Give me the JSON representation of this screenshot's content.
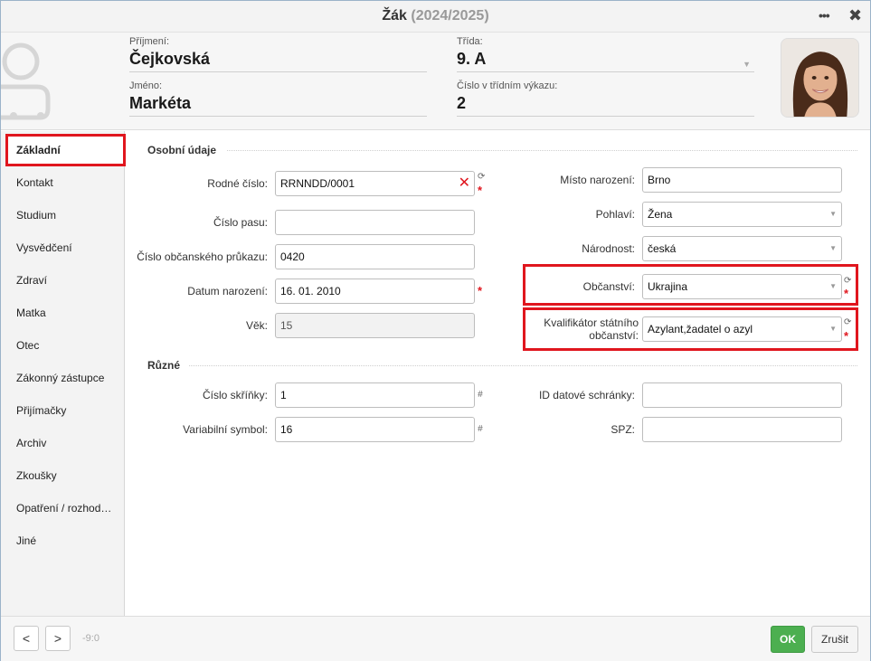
{
  "window": {
    "title": "Žák",
    "year": "(2024/2025)"
  },
  "header": {
    "surname_label": "Příjmení:",
    "surname": "Čejkovská",
    "name_label": "Jméno:",
    "name": "Markéta",
    "class_label": "Třída:",
    "class": "9. A",
    "class_number_label": "Číslo v třídním výkazu:",
    "class_number": "2"
  },
  "sidebar": {
    "items": [
      {
        "label": "Základní"
      },
      {
        "label": "Kontakt"
      },
      {
        "label": "Studium"
      },
      {
        "label": "Vysvědčení"
      },
      {
        "label": "Zdraví"
      },
      {
        "label": "Matka"
      },
      {
        "label": "Otec"
      },
      {
        "label": "Zákonný zástupce"
      },
      {
        "label": "Přijímačky"
      },
      {
        "label": "Archiv"
      },
      {
        "label": "Zkoušky"
      },
      {
        "label": "Opatření / rozhod…"
      },
      {
        "label": "Jiné"
      }
    ]
  },
  "sections": {
    "personal": "Osobní údaje",
    "misc": "Různé"
  },
  "fields": {
    "birth_number": {
      "label": "Rodné číslo:",
      "value": "RRNNDD/0001"
    },
    "passport": {
      "label": "Číslo pasu:",
      "value": ""
    },
    "id_card": {
      "label": "Číslo občanského průkazu:",
      "value": "0420"
    },
    "birth_date": {
      "label": "Datum narození:",
      "value": "16. 01. 2010"
    },
    "age": {
      "label": "Věk:",
      "value": "15"
    },
    "birth_place": {
      "label": "Místo narození:",
      "value": "Brno"
    },
    "gender": {
      "label": "Pohlaví:",
      "value": "Žena"
    },
    "nationality": {
      "label": "Národnost:",
      "value": "česká"
    },
    "citizenship": {
      "label": "Občanství:",
      "value": "Ukrajina"
    },
    "citizenship_qualifier": {
      "label_line1": "Kvalifikátor státního",
      "label_line2": "občanství:",
      "value": "Azylant,žadatel o azyl"
    },
    "locker": {
      "label": "Číslo skříňky:",
      "value": "1"
    },
    "variable_symbol": {
      "label": "Variabilní symbol:",
      "value": "16"
    },
    "databox": {
      "label": "ID datové schránky:",
      "value": ""
    },
    "spz": {
      "label": "SPZ:",
      "value": ""
    }
  },
  "footer": {
    "prev": "<",
    "next": ">",
    "info": "-9:0",
    "ok": "OK",
    "cancel": "Zrušit"
  },
  "icons": {
    "refresh": "refresh-icon",
    "required": "required-asterisk-icon",
    "hash": "hash-icon",
    "clear": "clear-icon",
    "dropdown": "chevron-down-icon"
  },
  "colors": {
    "highlight": "#e0161e",
    "ok": "#4caf50"
  }
}
